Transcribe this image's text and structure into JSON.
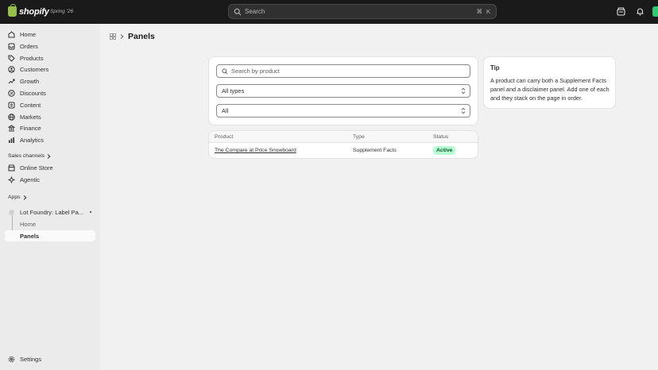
{
  "topbar": {
    "brand": "shopify",
    "edition": "Spring '26",
    "search_placeholder": "Search",
    "shortcut_keys": [
      "⌘",
      "K"
    ]
  },
  "sidebar": {
    "items": [
      {
        "label": "Home",
        "icon": "home-icon"
      },
      {
        "label": "Orders",
        "icon": "orders-icon"
      },
      {
        "label": "Products",
        "icon": "tag-icon"
      },
      {
        "label": "Customers",
        "icon": "person-icon"
      },
      {
        "label": "Growth",
        "icon": "growth-icon"
      },
      {
        "label": "Discounts",
        "icon": "discount-icon"
      },
      {
        "label": "Content",
        "icon": "content-icon"
      },
      {
        "label": "Markets",
        "icon": "globe-icon"
      },
      {
        "label": "Finance",
        "icon": "bank-icon"
      },
      {
        "label": "Analytics",
        "icon": "chart-icon"
      }
    ],
    "sales_channels_header": "Sales channels",
    "sales_channels": [
      {
        "label": "Online Store",
        "icon": "store-icon"
      },
      {
        "label": "Agentic",
        "icon": "agentic-icon"
      }
    ],
    "apps_header": "Apps",
    "app_name": "Lot Foundry: Label Pa...",
    "app_subitems": [
      "Home",
      "Panels"
    ],
    "settings": "Settings"
  },
  "main": {
    "page_title": "Panels",
    "search_placeholder": "Search by product",
    "type_filter": "All types",
    "status_filter": "All",
    "table": {
      "headers": [
        "Product",
        "Type",
        "Status"
      ],
      "rows": [
        {
          "product": "The Compare at Price Snowboard",
          "type": "Supplement Facts",
          "status": "Active"
        }
      ]
    },
    "tip": {
      "title": "Tip",
      "body": "A product can carry both a Supplement Facts panel and a disclaimer panel. Add one of each and they stack on the page in order."
    }
  },
  "colors": {
    "topbar": "#1a1a1a",
    "brand_green": "#95bf47",
    "active_badge_bg": "#b4fed2",
    "active_badge_text": "#0c5132"
  }
}
